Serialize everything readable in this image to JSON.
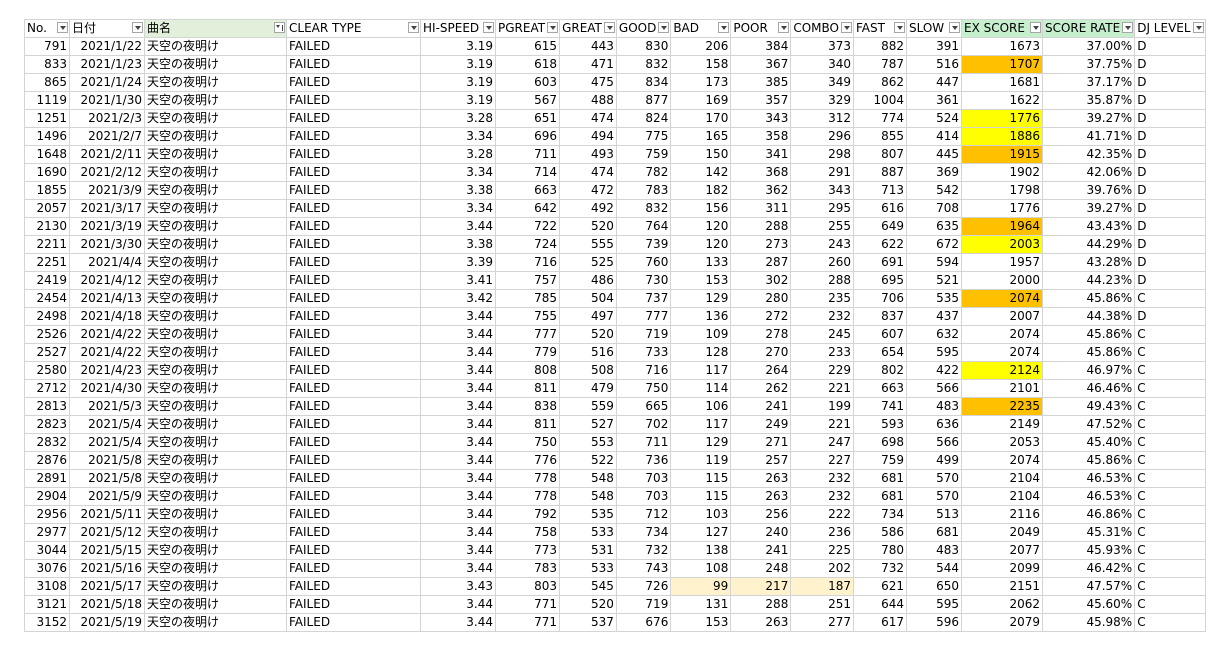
{
  "columns": [
    {
      "label": "No.",
      "style": ""
    },
    {
      "label": "日付",
      "style": ""
    },
    {
      "label": "曲名",
      "style": "filter-hi",
      "filtered": true
    },
    {
      "label": "CLEAR TYPE",
      "style": ""
    },
    {
      "label": "HI-SPEED",
      "style": ""
    },
    {
      "label": "PGREAT",
      "style": ""
    },
    {
      "label": "GREAT",
      "style": ""
    },
    {
      "label": "GOOD",
      "style": ""
    },
    {
      "label": "BAD",
      "style": ""
    },
    {
      "label": "POOR",
      "style": ""
    },
    {
      "label": "COMBO",
      "style": ""
    },
    {
      "label": "FAST",
      "style": ""
    },
    {
      "label": "SLOW",
      "style": ""
    },
    {
      "label": "EX SCORE",
      "style": "green"
    },
    {
      "label": "SCORE RATE",
      "style": "green"
    },
    {
      "label": "DJ LEVEL",
      "style": ""
    }
  ],
  "colors": {
    "yellow": "#ffff00",
    "orange": "#ffc000",
    "cream": "#fff2cc",
    "separator": "#00a050"
  },
  "rows": [
    {
      "c": [
        "791",
        "2021/1/22",
        "天空の夜明け",
        "FAILED",
        "3.19",
        "615",
        "443",
        "830",
        "206",
        "384",
        "373",
        "882",
        "391",
        "1673",
        "37.00%",
        "D"
      ]
    },
    {
      "c": [
        "833",
        "2021/1/23",
        "天空の夜明け",
        "FAILED",
        "3.19",
        "618",
        "471",
        "832",
        "158",
        "367",
        "340",
        "787",
        "516",
        "1707",
        "37.75%",
        "D"
      ],
      "hl": {
        "13": "orange"
      }
    },
    {
      "c": [
        "865",
        "2021/1/24",
        "天空の夜明け",
        "FAILED",
        "3.19",
        "603",
        "475",
        "834",
        "173",
        "385",
        "349",
        "862",
        "447",
        "1681",
        "37.17%",
        "D"
      ]
    },
    {
      "c": [
        "1119",
        "2021/1/30",
        "天空の夜明け",
        "FAILED",
        "3.19",
        "567",
        "488",
        "877",
        "169",
        "357",
        "329",
        "1004",
        "361",
        "1622",
        "35.87%",
        "D"
      ],
      "sep": true
    },
    {
      "c": [
        "1251",
        "2021/2/3",
        "天空の夜明け",
        "FAILED",
        "3.28",
        "651",
        "474",
        "824",
        "170",
        "343",
        "312",
        "774",
        "524",
        "1776",
        "39.27%",
        "D"
      ],
      "hl": {
        "13": "yellow"
      }
    },
    {
      "c": [
        "1496",
        "2021/2/7",
        "天空の夜明け",
        "FAILED",
        "3.34",
        "696",
        "494",
        "775",
        "165",
        "358",
        "296",
        "855",
        "414",
        "1886",
        "41.71%",
        "D"
      ],
      "hl": {
        "13": "yellow"
      }
    },
    {
      "c": [
        "1648",
        "2021/2/11",
        "天空の夜明け",
        "FAILED",
        "3.28",
        "711",
        "493",
        "759",
        "150",
        "341",
        "298",
        "807",
        "445",
        "1915",
        "42.35%",
        "D"
      ],
      "hl": {
        "13": "orange"
      }
    },
    {
      "c": [
        "1690",
        "2021/2/12",
        "天空の夜明け",
        "FAILED",
        "3.34",
        "714",
        "474",
        "782",
        "142",
        "368",
        "291",
        "887",
        "369",
        "1902",
        "42.06%",
        "D"
      ]
    },
    {
      "c": [
        "1855",
        "2021/3/9",
        "天空の夜明け",
        "FAILED",
        "3.38",
        "663",
        "472",
        "783",
        "182",
        "362",
        "343",
        "713",
        "542",
        "1798",
        "39.76%",
        "D"
      ],
      "sep": true
    },
    {
      "c": [
        "2057",
        "2021/3/17",
        "天空の夜明け",
        "FAILED",
        "3.34",
        "642",
        "492",
        "832",
        "156",
        "311",
        "295",
        "616",
        "708",
        "1776",
        "39.27%",
        "D"
      ]
    },
    {
      "c": [
        "2130",
        "2021/3/19",
        "天空の夜明け",
        "FAILED",
        "3.44",
        "722",
        "520",
        "764",
        "120",
        "288",
        "255",
        "649",
        "635",
        "1964",
        "43.43%",
        "D"
      ],
      "hl": {
        "13": "orange"
      },
      "sep": true
    },
    {
      "c": [
        "2211",
        "2021/3/30",
        "天空の夜明け",
        "FAILED",
        "3.38",
        "724",
        "555",
        "739",
        "120",
        "273",
        "243",
        "622",
        "672",
        "2003",
        "44.29%",
        "D"
      ],
      "hl": {
        "13": "yellow"
      }
    },
    {
      "c": [
        "2251",
        "2021/4/4",
        "天空の夜明け",
        "FAILED",
        "3.39",
        "716",
        "525",
        "760",
        "133",
        "287",
        "260",
        "691",
        "594",
        "1957",
        "43.28%",
        "D"
      ]
    },
    {
      "c": [
        "2419",
        "2021/4/12",
        "天空の夜明け",
        "FAILED",
        "3.41",
        "757",
        "486",
        "730",
        "153",
        "302",
        "288",
        "695",
        "521",
        "2000",
        "44.23%",
        "D"
      ]
    },
    {
      "c": [
        "2454",
        "2021/4/13",
        "天空の夜明け",
        "FAILED",
        "3.42",
        "785",
        "504",
        "737",
        "129",
        "280",
        "235",
        "706",
        "535",
        "2074",
        "45.86%",
        "C"
      ],
      "hl": {
        "13": "orange"
      },
      "sep": true
    },
    {
      "c": [
        "2498",
        "2021/4/18",
        "天空の夜明け",
        "FAILED",
        "3.44",
        "755",
        "497",
        "777",
        "136",
        "272",
        "232",
        "837",
        "437",
        "2007",
        "44.38%",
        "D"
      ]
    },
    {
      "c": [
        "2526",
        "2021/4/22",
        "天空の夜明け",
        "FAILED",
        "3.44",
        "777",
        "520",
        "719",
        "109",
        "278",
        "245",
        "607",
        "632",
        "2074",
        "45.86%",
        "C"
      ]
    },
    {
      "c": [
        "2527",
        "2021/4/22",
        "天空の夜明け",
        "FAILED",
        "3.44",
        "779",
        "516",
        "733",
        "128",
        "270",
        "233",
        "654",
        "595",
        "2074",
        "45.86%",
        "C"
      ]
    },
    {
      "c": [
        "2580",
        "2021/4/23",
        "天空の夜明け",
        "FAILED",
        "3.44",
        "808",
        "508",
        "716",
        "117",
        "264",
        "229",
        "802",
        "422",
        "2124",
        "46.97%",
        "C"
      ],
      "hl": {
        "13": "yellow"
      }
    },
    {
      "c": [
        "2712",
        "2021/4/30",
        "天空の夜明け",
        "FAILED",
        "3.44",
        "811",
        "479",
        "750",
        "114",
        "262",
        "221",
        "663",
        "566",
        "2101",
        "46.46%",
        "C"
      ]
    },
    {
      "c": [
        "2813",
        "2021/5/3",
        "天空の夜明け",
        "FAILED",
        "3.44",
        "838",
        "559",
        "665",
        "106",
        "241",
        "199",
        "741",
        "483",
        "2235",
        "49.43%",
        "C"
      ],
      "hl": {
        "13": "orange"
      }
    },
    {
      "c": [
        "2823",
        "2021/5/4",
        "天空の夜明け",
        "FAILED",
        "3.44",
        "811",
        "527",
        "702",
        "117",
        "249",
        "221",
        "593",
        "636",
        "2149",
        "47.52%",
        "C"
      ]
    },
    {
      "c": [
        "2832",
        "2021/5/4",
        "天空の夜明け",
        "FAILED",
        "3.44",
        "750",
        "553",
        "711",
        "129",
        "271",
        "247",
        "698",
        "566",
        "2053",
        "45.40%",
        "C"
      ],
      "sep": true
    },
    {
      "c": [
        "2876",
        "2021/5/8",
        "天空の夜明け",
        "FAILED",
        "3.44",
        "776",
        "522",
        "736",
        "119",
        "257",
        "227",
        "759",
        "499",
        "2074",
        "45.86%",
        "C"
      ]
    },
    {
      "c": [
        "2891",
        "2021/5/8",
        "天空の夜明け",
        "FAILED",
        "3.44",
        "778",
        "548",
        "703",
        "115",
        "263",
        "232",
        "681",
        "570",
        "2104",
        "46.53%",
        "C"
      ]
    },
    {
      "c": [
        "2904",
        "2021/5/9",
        "天空の夜明け",
        "FAILED",
        "3.44",
        "778",
        "548",
        "703",
        "115",
        "263",
        "232",
        "681",
        "570",
        "2104",
        "46.53%",
        "C"
      ]
    },
    {
      "c": [
        "2956",
        "2021/5/11",
        "天空の夜明け",
        "FAILED",
        "3.44",
        "792",
        "535",
        "712",
        "103",
        "256",
        "222",
        "734",
        "513",
        "2116",
        "46.86%",
        "C"
      ]
    },
    {
      "c": [
        "2977",
        "2021/5/12",
        "天空の夜明け",
        "FAILED",
        "3.44",
        "758",
        "533",
        "734",
        "127",
        "240",
        "236",
        "586",
        "681",
        "2049",
        "45.31%",
        "C"
      ]
    },
    {
      "c": [
        "3044",
        "2021/5/15",
        "天空の夜明け",
        "FAILED",
        "3.44",
        "773",
        "531",
        "732",
        "138",
        "241",
        "225",
        "780",
        "483",
        "2077",
        "45.93%",
        "C"
      ]
    },
    {
      "c": [
        "3076",
        "2021/5/16",
        "天空の夜明け",
        "FAILED",
        "3.44",
        "783",
        "533",
        "743",
        "108",
        "248",
        "202",
        "732",
        "544",
        "2099",
        "46.42%",
        "C"
      ]
    },
    {
      "c": [
        "3108",
        "2021/5/17",
        "天空の夜明け",
        "FAILED",
        "3.43",
        "803",
        "545",
        "726",
        "99",
        "217",
        "187",
        "621",
        "650",
        "2151",
        "47.57%",
        "C"
      ],
      "hl": {
        "8": "cream",
        "9": "cream",
        "10": "cream"
      }
    },
    {
      "c": [
        "3121",
        "2021/5/18",
        "天空の夜明け",
        "FAILED",
        "3.44",
        "771",
        "520",
        "719",
        "131",
        "288",
        "251",
        "644",
        "595",
        "2062",
        "45.60%",
        "C"
      ]
    },
    {
      "c": [
        "3152",
        "2021/5/19",
        "天空の夜明け",
        "FAILED",
        "3.44",
        "771",
        "537",
        "676",
        "153",
        "263",
        "277",
        "617",
        "596",
        "2079",
        "45.98%",
        "C"
      ]
    }
  ]
}
